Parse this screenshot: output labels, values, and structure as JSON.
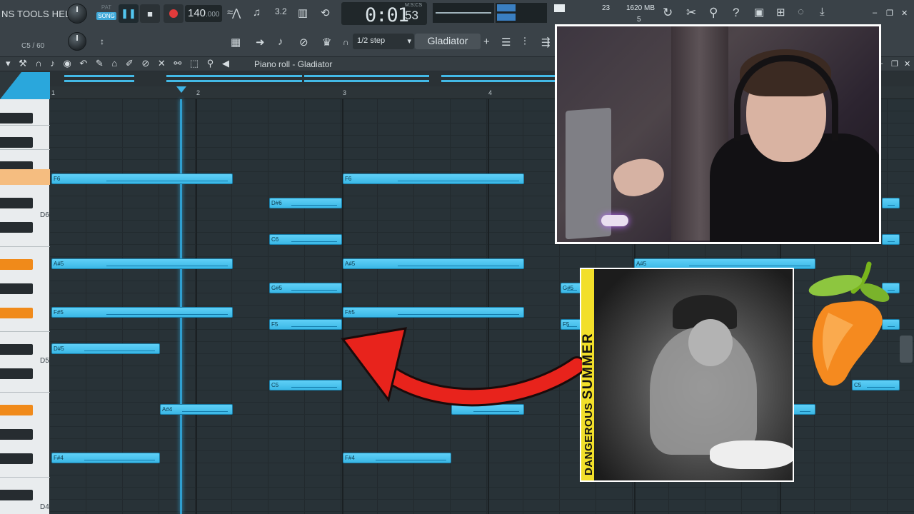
{
  "menu": {
    "text": "NS TOOLS HELP"
  },
  "transport": {
    "pat_label": "PAT",
    "song_label": "SONG",
    "tempo_whole": "140",
    "tempo_frac": ".000",
    "time_main": "0:01",
    "time_sub_label": "M:S:CS",
    "time_frac": "53"
  },
  "stats": {
    "cpu_num": "23",
    "memory": "1620 MB",
    "polyphony": "5"
  },
  "toolbar": {
    "note_label": "C5 / 60",
    "step": "1/2 step",
    "pattern": "Gladiator",
    "add": "+"
  },
  "piano_roll": {
    "title": "Piano roll - Gladiator",
    "ruler": [
      "1",
      "2",
      "3",
      "4"
    ]
  },
  "keyboard": {
    "octaves": [
      "D6",
      "D5",
      "D4"
    ]
  },
  "notes": [
    {
      "label": "F6"
    },
    {
      "label": "F6"
    },
    {
      "label": "D#6"
    },
    {
      "label": "C6"
    },
    {
      "label": "A#5"
    },
    {
      "label": "A#5"
    },
    {
      "label": "A#5"
    },
    {
      "label": "G#5"
    },
    {
      "label": "G#5"
    },
    {
      "label": "F#5"
    },
    {
      "label": "F#5"
    },
    {
      "label": "F5"
    },
    {
      "label": "F5"
    },
    {
      "label": "D#5"
    },
    {
      "label": "C5"
    },
    {
      "label": "C5"
    },
    {
      "label": "A#4"
    },
    {
      "label": "F#4"
    },
    {
      "label": "F#4"
    }
  ],
  "album": {
    "line1": "DANGEROUS",
    "line2": "SUMMER"
  },
  "colors": {
    "note": "#3ab7e6",
    "accent": "#2aa7dc",
    "arrow": "#e8231c",
    "highlight_key": "#f08a1a"
  }
}
